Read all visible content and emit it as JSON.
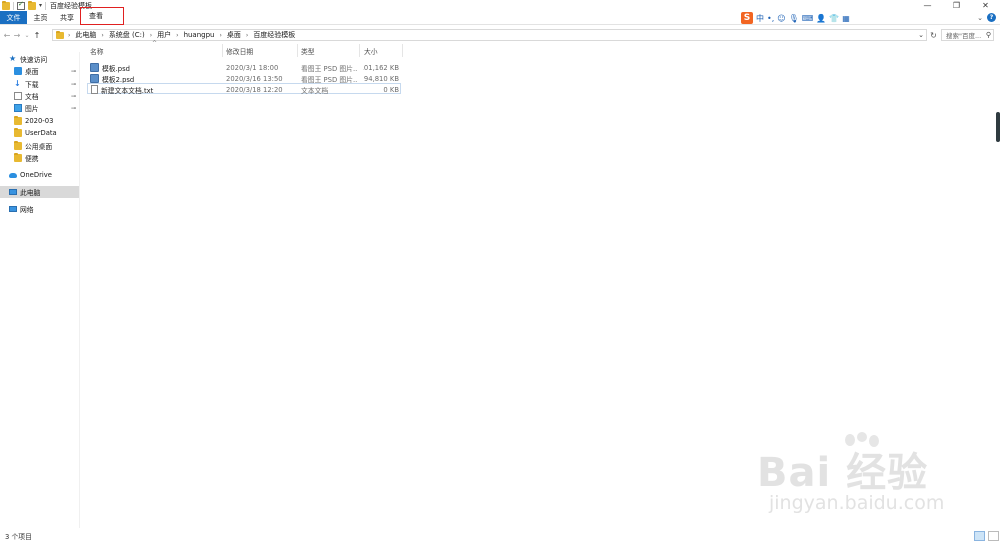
{
  "window": {
    "title": "百度经验模板",
    "controls": {
      "minimize": "—",
      "restore": "❐",
      "close": "✕"
    }
  },
  "ribbon": {
    "tabs": [
      {
        "label": "文件",
        "active": true
      },
      {
        "label": "主页"
      },
      {
        "label": "共享"
      },
      {
        "label": "查看",
        "highlighted": true
      }
    ],
    "expand_glyph": "⌄",
    "help_glyph": "?"
  },
  "ime_toolbar": {
    "logo": "S",
    "items": [
      "中",
      "•,",
      "☺",
      "🎙",
      "⌨",
      "👤",
      "👕",
      "▦"
    ]
  },
  "navigation": {
    "back_glyph": "←",
    "forward_glyph": "→",
    "recent_glyph": "⌄",
    "up_glyph": "↑",
    "breadcrumbs": [
      "此电脑",
      "系统盘 (C:)",
      "用户",
      "huangpu",
      "桌面",
      "百度经验模板"
    ],
    "crumb_separator": "›",
    "dropdown_glyph": "⌄",
    "refresh_glyph": "↻",
    "search_placeholder": "搜索\"百度...",
    "search_glyph": "⚲"
  },
  "sidebar": {
    "quick_access": "快速访问",
    "pinned": [
      {
        "label": "桌面",
        "icon": "desktop-icon",
        "pinned": true
      },
      {
        "label": "下载",
        "icon": "download-icon",
        "pinned": true
      },
      {
        "label": "文档",
        "icon": "documents-icon",
        "pinned": true
      },
      {
        "label": "图片",
        "icon": "pictures-icon",
        "pinned": true
      }
    ],
    "folders": [
      "2020-03",
      "UserData",
      "公用桌面",
      "便携"
    ],
    "onedrive": "OneDrive",
    "this_pc": "此电脑",
    "network": "网络",
    "pin_glyph": "📌"
  },
  "columns": {
    "name": "名称",
    "modified": "修改日期",
    "type": "类型",
    "size": "大小",
    "sort_glyph": "^"
  },
  "files": [
    {
      "name": "模板.psd",
      "modified": "2020/3/1 18:00",
      "type": "看图王 PSD 图片...",
      "size": "101,162 KB",
      "icon": "psd-file-icon"
    },
    {
      "name": "模板2.psd",
      "modified": "2020/3/16 13:50",
      "type": "看图王 PSD 图片...",
      "size": "94,810 KB",
      "icon": "psd-file-icon"
    },
    {
      "name": "新建文本文档.txt",
      "modified": "2020/3/18 12:20",
      "type": "文本文档",
      "size": "0 KB",
      "icon": "txt-file-icon"
    }
  ],
  "status": {
    "item_count": "3 个项目"
  },
  "watermark": {
    "brand": "Bai  经验",
    "url": "jingyan.baidu.com"
  },
  "colors": {
    "accent": "#1a6fc2",
    "highlight_box": "#e02020",
    "selected": "#d9d9d9"
  }
}
